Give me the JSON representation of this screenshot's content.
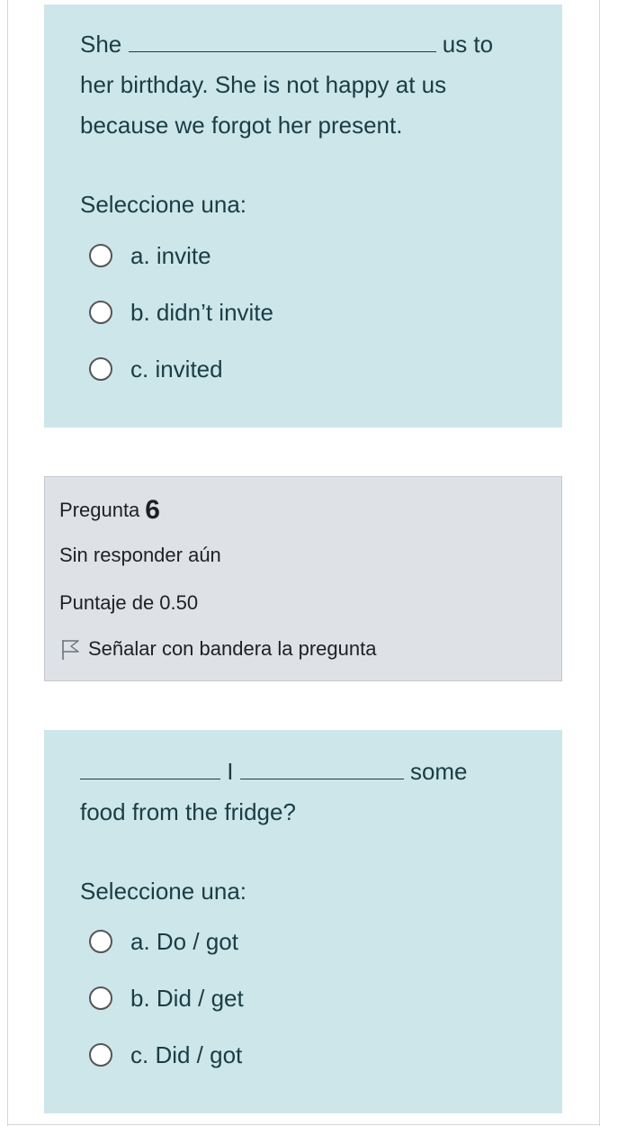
{
  "question5": {
    "text_part1": "She",
    "text_part2": "us to",
    "text_line2": "her birthday. She is not happy at us",
    "text_line3": "because we forgot her present.",
    "prompt": "Seleccione una:",
    "options": [
      {
        "label": "a. invite"
      },
      {
        "label": "b. didn’t invite"
      },
      {
        "label": "c. invited"
      }
    ]
  },
  "question6_info": {
    "label": "Pregunta",
    "number": "6",
    "status": "Sin responder aún",
    "score": "Puntaje de 0.50",
    "flag_label": "Señalar con bandera la pregunta"
  },
  "question6": {
    "text_sep": "I",
    "text_end": "some",
    "text_line2": "food from the fridge?",
    "prompt": "Seleccione una:",
    "options": [
      {
        "label": "a. Do / got"
      },
      {
        "label": "b. Did / get"
      },
      {
        "label": "c. Did / got"
      }
    ]
  },
  "icons": {
    "flag": "flag-icon",
    "radio": "radio-unchecked-icon"
  },
  "colors": {
    "question_bg": "#cde6ea",
    "info_bg": "#dee2e6",
    "question_text": "#1a3d45"
  }
}
